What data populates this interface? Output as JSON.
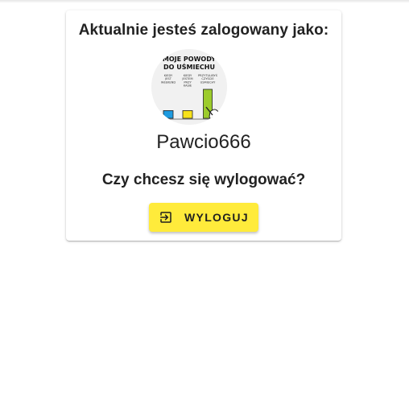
{
  "card": {
    "heading": "Aktualnie jesteś zalogowany jako:",
    "username": "Pawcio666",
    "question": "Czy chcesz się wylogować?",
    "logout_label": "WYLOGUJ"
  },
  "avatar_image": {
    "title_line1": "MOJE POWODY",
    "title_line2": "DO UŚMIECHU",
    "bars": [
      {
        "label_lines": [
          "KIEDY",
          "JEST",
          "WEEKEND"
        ],
        "level": 0.2,
        "color": "#1e9be0"
      },
      {
        "label_lines": [
          "KIEDY",
          "JESTEM",
          "PRZY",
          "KASIE"
        ],
        "level": 0.2,
        "color": "#f7e21b"
      },
      {
        "label_lines": [
          "PRZYTULIBYŚ",
          "CZYŚCIE",
          "UŚMIECHY"
        ],
        "level": 0.75,
        "color": "#9ccc2b"
      }
    ]
  },
  "colors": {
    "button": "#ffeb3b",
    "text": "#222222",
    "card_bg": "#ffffff"
  },
  "icons": {
    "logout": "logout-icon"
  }
}
